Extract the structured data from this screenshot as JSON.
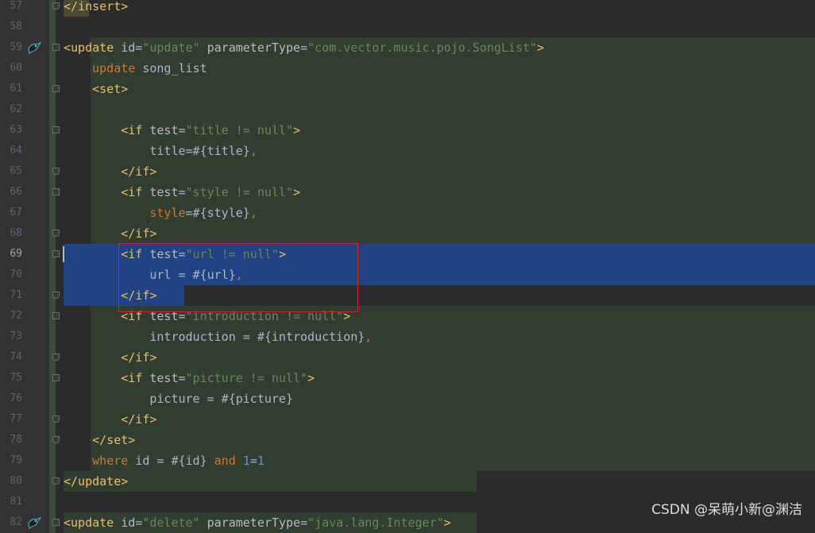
{
  "editor": {
    "lines": [
      {
        "num": "57",
        "code": [
          [
            "tag",
            "</insert>"
          ]
        ]
      },
      {
        "num": "58",
        "code": []
      },
      {
        "num": "59",
        "code": [
          [
            "tag",
            "<update "
          ],
          [
            "attr",
            "id"
          ],
          [
            "txt",
            "="
          ],
          [
            "val",
            "\"update\""
          ],
          [
            "txt",
            " "
          ],
          [
            "attr",
            "parameterType"
          ],
          [
            "txt",
            "="
          ],
          [
            "val",
            "\"com.vector.music.pojo.SongList\""
          ],
          [
            "tag",
            ">"
          ]
        ]
      },
      {
        "num": "60",
        "code": [
          [
            "txt",
            "    "
          ],
          [
            "kw",
            "update"
          ],
          [
            "txt",
            " song_list"
          ]
        ]
      },
      {
        "num": "61",
        "code": [
          [
            "txt",
            "    "
          ],
          [
            "tag",
            "<set>"
          ]
        ]
      },
      {
        "num": "62",
        "code": []
      },
      {
        "num": "63",
        "code": [
          [
            "txt",
            "        "
          ],
          [
            "tag",
            "<if "
          ],
          [
            "attr",
            "test"
          ],
          [
            "txt",
            "="
          ],
          [
            "val",
            "\"title != null\""
          ],
          [
            "tag",
            ">"
          ]
        ]
      },
      {
        "num": "64",
        "code": [
          [
            "txt",
            "            title=#{title}"
          ],
          [
            "kw",
            ","
          ]
        ]
      },
      {
        "num": "65",
        "code": [
          [
            "txt",
            "        "
          ],
          [
            "tag",
            "</if>"
          ]
        ]
      },
      {
        "num": "66",
        "code": [
          [
            "txt",
            "        "
          ],
          [
            "tag",
            "<if "
          ],
          [
            "attr",
            "test"
          ],
          [
            "txt",
            "="
          ],
          [
            "val",
            "\"style != null\""
          ],
          [
            "tag",
            ">"
          ]
        ]
      },
      {
        "num": "67",
        "code": [
          [
            "txt",
            "            "
          ],
          [
            "kw",
            "style"
          ],
          [
            "txt",
            "=#{style}"
          ],
          [
            "kw",
            ","
          ]
        ]
      },
      {
        "num": "68",
        "code": [
          [
            "txt",
            "        "
          ],
          [
            "tag",
            "</if>"
          ]
        ]
      },
      {
        "num": "69",
        "code": [
          [
            "txt",
            "        "
          ],
          [
            "tag",
            "<if "
          ],
          [
            "attr",
            "test"
          ],
          [
            "txt",
            "="
          ],
          [
            "val",
            "\"url != null\""
          ],
          [
            "tag",
            ">"
          ]
        ]
      },
      {
        "num": "70",
        "code": [
          [
            "txt",
            "            url = #{url}"
          ],
          [
            "kw",
            ","
          ]
        ]
      },
      {
        "num": "71",
        "code": [
          [
            "txt",
            "        "
          ],
          [
            "tag",
            "</if>"
          ]
        ]
      },
      {
        "num": "72",
        "code": [
          [
            "txt",
            "        "
          ],
          [
            "tag",
            "<if "
          ],
          [
            "attr",
            "test"
          ],
          [
            "txt",
            "="
          ],
          [
            "val",
            "\"introduction != null\""
          ],
          [
            "tag",
            ">"
          ]
        ]
      },
      {
        "num": "73",
        "code": [
          [
            "txt",
            "            introduction = #{introduction}"
          ],
          [
            "kw",
            ","
          ]
        ]
      },
      {
        "num": "74",
        "code": [
          [
            "txt",
            "        "
          ],
          [
            "tag",
            "</if>"
          ]
        ]
      },
      {
        "num": "75",
        "code": [
          [
            "txt",
            "        "
          ],
          [
            "tag",
            "<if "
          ],
          [
            "attr",
            "test"
          ],
          [
            "txt",
            "="
          ],
          [
            "val",
            "\"picture != null\""
          ],
          [
            "tag",
            ">"
          ]
        ]
      },
      {
        "num": "76",
        "code": [
          [
            "txt",
            "            picture = #{picture}"
          ]
        ]
      },
      {
        "num": "77",
        "code": [
          [
            "txt",
            "        "
          ],
          [
            "tag",
            "</if>"
          ]
        ]
      },
      {
        "num": "78",
        "code": [
          [
            "txt",
            "    "
          ],
          [
            "tag",
            "</set>"
          ]
        ]
      },
      {
        "num": "79",
        "code": [
          [
            "txt",
            "    "
          ],
          [
            "kw",
            "where"
          ],
          [
            "txt",
            " id = #{id} "
          ],
          [
            "kw",
            "and"
          ],
          [
            "txt",
            " "
          ],
          [
            "num",
            "1"
          ],
          [
            "txt",
            "="
          ],
          [
            "num",
            "1"
          ]
        ]
      },
      {
        "num": "80",
        "code": [
          [
            "tag",
            "</update>"
          ]
        ]
      },
      {
        "num": "81",
        "code": []
      },
      {
        "num": "82",
        "code": [
          [
            "tag",
            "<update "
          ],
          [
            "attr",
            "id"
          ],
          [
            "txt",
            "="
          ],
          [
            "val",
            "\"delete\""
          ],
          [
            "txt",
            " "
          ],
          [
            "attr",
            "parameterType"
          ],
          [
            "txt",
            "="
          ],
          [
            "val",
            "\"java.lang.Integer\""
          ],
          [
            "tag",
            ">"
          ]
        ]
      }
    ],
    "current_line": "69"
  },
  "watermark": "CSDN @呆萌小新@渊洁",
  "colors": {
    "background": "#2b2b2b",
    "gutter": "#313335",
    "selection": "#214283",
    "tag": "#e8bf6a",
    "string": "#6a8759",
    "keyword": "#cc7832",
    "highlight_box": "#d0242b"
  },
  "icons": {
    "run_gutter": "mybatis-bird-icon",
    "fold": "fold-marker-icon"
  }
}
